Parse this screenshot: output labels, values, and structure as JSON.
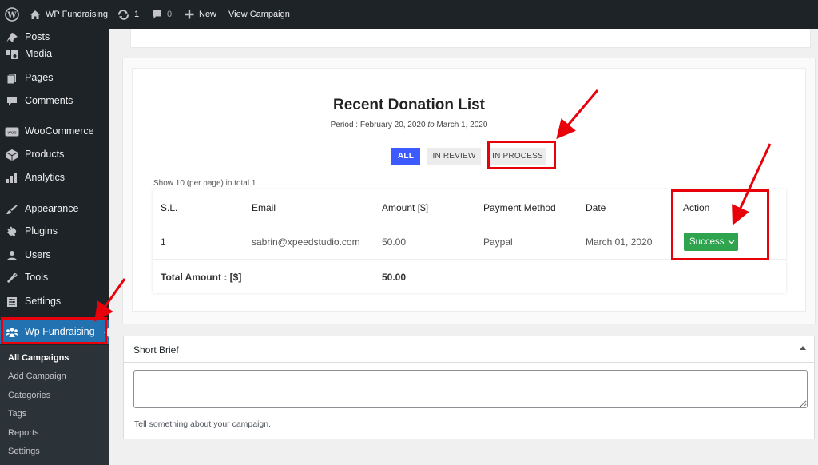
{
  "adminbar": {
    "site_name": "WP Fundraising",
    "updates_count": "1",
    "comments_count": "0",
    "new_label": "New",
    "view_label": "View Campaign",
    "icons": [
      "wordpress-icon",
      "home-icon",
      "updates-icon",
      "comments-icon",
      "plus-icon"
    ]
  },
  "sidebar": {
    "items": [
      {
        "label": "Posts",
        "icon": "pin-icon"
      },
      {
        "label": "Media",
        "icon": "media-icon"
      },
      {
        "label": "Pages",
        "icon": "pages-icon"
      },
      {
        "label": "Comments",
        "icon": "comments-icon"
      },
      {
        "label": "WooCommerce",
        "icon": "woo-icon"
      },
      {
        "label": "Products",
        "icon": "products-icon"
      },
      {
        "label": "Analytics",
        "icon": "analytics-icon"
      },
      {
        "label": "Appearance",
        "icon": "appearance-icon"
      },
      {
        "label": "Plugins",
        "icon": "plugins-icon"
      },
      {
        "label": "Users",
        "icon": "users-icon"
      },
      {
        "label": "Tools",
        "icon": "tools-icon"
      },
      {
        "label": "Settings",
        "icon": "settings-icon"
      },
      {
        "label": "Wp Fundraising",
        "icon": "fundraising-icon",
        "current": true
      }
    ],
    "submenu": [
      "All Campaigns",
      "Add Campaign",
      "Categories",
      "Tags",
      "Reports",
      "Settings"
    ]
  },
  "donations": {
    "title": "Recent Donation List",
    "period_prefix": "Period : February 20, 2020",
    "period_to": "to",
    "period_end": "March 1, 2020",
    "filters": [
      "ALL",
      "IN REVIEW",
      "IN PROCESS"
    ],
    "show_info": "Show 10 (per page) in total 1",
    "columns": [
      "S.L.",
      "Email",
      "Amount [$]",
      "Payment Method",
      "Date",
      "Action"
    ],
    "rows": [
      {
        "sl": "1",
        "email": "sabrin@xpeedstudio.com",
        "amount": "50.00",
        "method": "Paypal",
        "date": "March 01, 2020",
        "action": "Success"
      }
    ],
    "total_label": "Total Amount : [$]",
    "total_value": "50.00"
  },
  "brief": {
    "title": "Short Brief",
    "help_text": "Tell something about your campaign."
  },
  "colors": {
    "admin_dark": "#1d2327",
    "highlight_blue": "#2271b1",
    "filter_active": "#3d5afe",
    "success_green": "#2ea44f",
    "annotation_red": "#e8000b"
  }
}
